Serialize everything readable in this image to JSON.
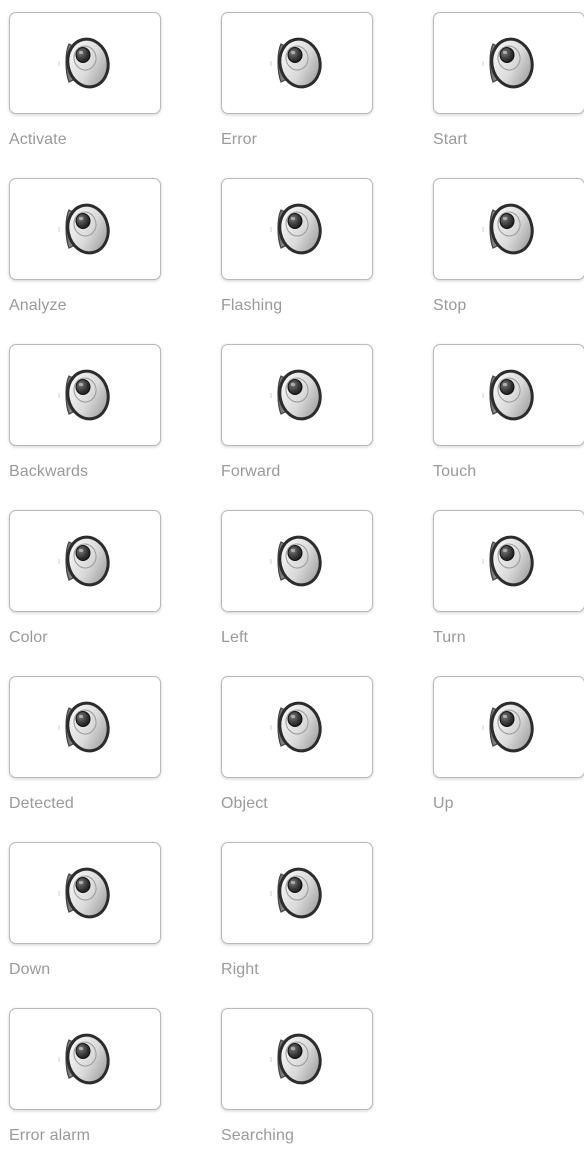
{
  "sounds": [
    {
      "label": "Activate",
      "icon": "speaker-icon"
    },
    {
      "label": "Error",
      "icon": "speaker-icon"
    },
    {
      "label": "Start",
      "icon": "speaker-icon"
    },
    {
      "label": "Analyze",
      "icon": "speaker-icon"
    },
    {
      "label": "Flashing",
      "icon": "speaker-icon"
    },
    {
      "label": "Stop",
      "icon": "speaker-icon"
    },
    {
      "label": "Backwards",
      "icon": "speaker-icon"
    },
    {
      "label": "Forward",
      "icon": "speaker-icon"
    },
    {
      "label": "Touch",
      "icon": "speaker-icon"
    },
    {
      "label": "Color",
      "icon": "speaker-icon"
    },
    {
      "label": "Left",
      "icon": "speaker-icon"
    },
    {
      "label": "Turn",
      "icon": "speaker-icon"
    },
    {
      "label": "Detected",
      "icon": "speaker-icon"
    },
    {
      "label": "Object",
      "icon": "speaker-icon"
    },
    {
      "label": "Up",
      "icon": "speaker-icon"
    },
    {
      "label": "Down",
      "icon": "speaker-icon"
    },
    {
      "label": "Right",
      "icon": "speaker-icon"
    },
    {
      "label": "Error alarm",
      "icon": "speaker-icon"
    },
    {
      "label": "Searching",
      "icon": "speaker-icon"
    }
  ],
  "colors": {
    "label_text": "#9a9a9a",
    "card_border": "#b9b9b9",
    "card_background": "#ffffff"
  }
}
